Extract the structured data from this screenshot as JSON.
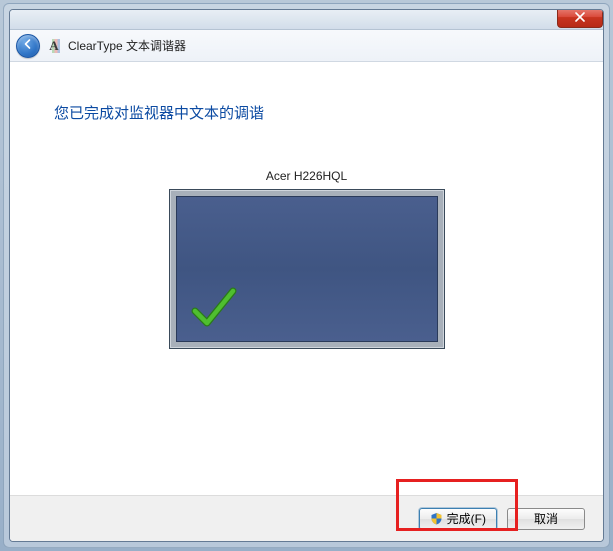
{
  "header": {
    "title": "ClearType 文本调谐器",
    "app_icon_letter": "A"
  },
  "content": {
    "heading": "您已完成对监视器中文本的调谐",
    "monitor_name": "Acer H226HQL"
  },
  "footer": {
    "finish_label": "完成(F)",
    "cancel_label": "取消"
  }
}
